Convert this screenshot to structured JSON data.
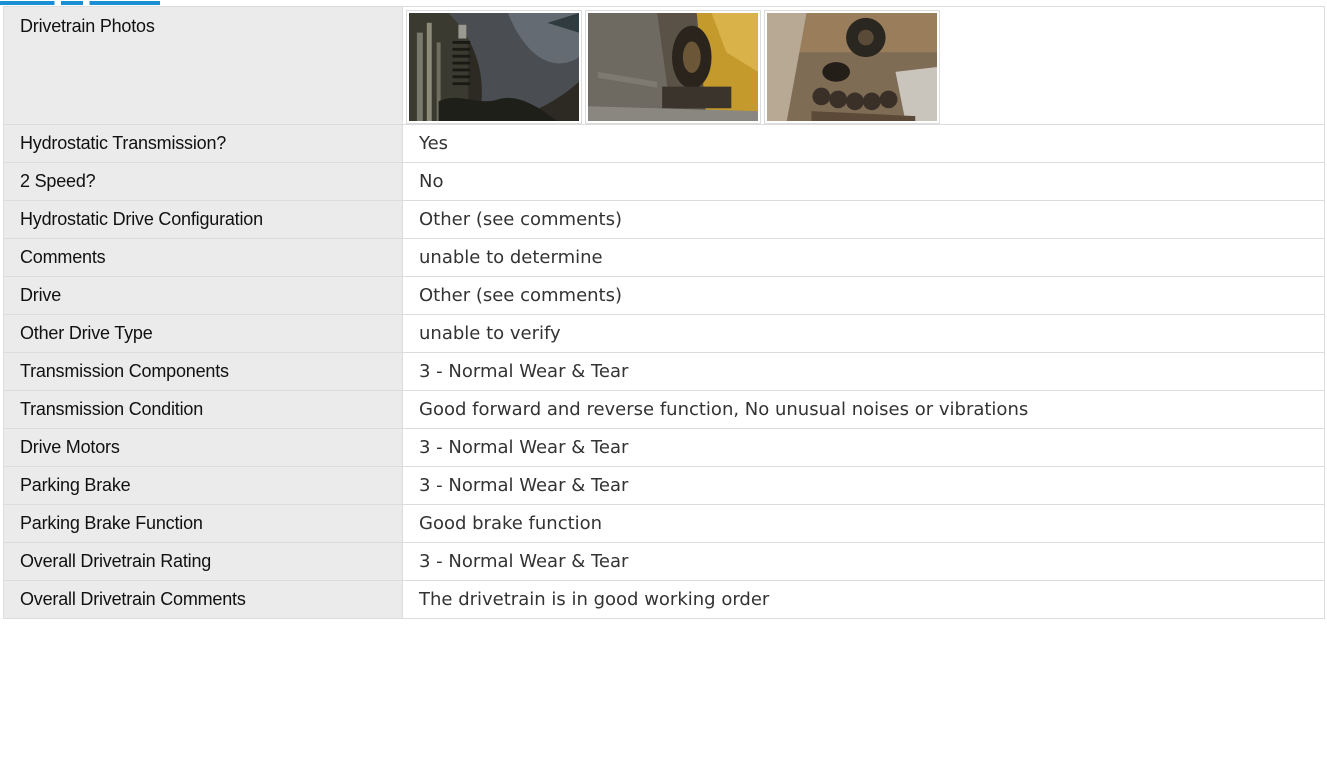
{
  "section": {
    "heading": ""
  },
  "photos": {
    "label": "Drivetrain Photos",
    "items": [
      {
        "icon": "drivetrain-photo-1-image"
      },
      {
        "icon": "drivetrain-photo-2-image"
      },
      {
        "icon": "drivetrain-photo-3-image"
      }
    ]
  },
  "rows": [
    {
      "label": "Hydrostatic Transmission?",
      "value": "Yes"
    },
    {
      "label": "2 Speed?",
      "value": "No"
    },
    {
      "label": "Hydrostatic Drive Configuration",
      "value": "Other (see comments)"
    },
    {
      "label": "Comments",
      "value": "unable to determine"
    },
    {
      "label": "Drive",
      "value": "Other (see comments)"
    },
    {
      "label": "Other Drive Type",
      "value": "unable to verify"
    },
    {
      "label": "Transmission Components",
      "value": "3 - Normal Wear & Tear"
    },
    {
      "label": "Transmission Condition",
      "value": "Good forward and reverse function, No unusual noises or vibrations"
    },
    {
      "label": "Drive Motors",
      "value": "3 - Normal Wear & Tear"
    },
    {
      "label": "Parking Brake",
      "value": "3 - Normal Wear & Tear"
    },
    {
      "label": "Parking Brake Function",
      "value": "Good brake function"
    },
    {
      "label": "Overall Drivetrain Rating",
      "value": "3 - Normal Wear & Tear"
    },
    {
      "label": "Overall Drivetrain Comments",
      "value": "The drivetrain is in good working order"
    }
  ],
  "colors": {
    "label_background": "#ebebeb",
    "border": "#dcdcdc",
    "heading_accent": "#1a8fd6"
  }
}
